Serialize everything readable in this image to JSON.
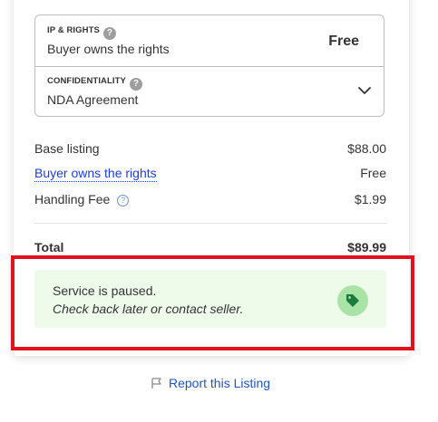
{
  "options": {
    "ip_rights": {
      "label": "IP & RIGHTS",
      "help": "?",
      "value": "Buyer owns the rights",
      "price": "Free"
    },
    "confidentiality": {
      "label": "CONFIDENTIALITY",
      "help": "?",
      "value": "NDA Agreement",
      "icon": "chevron-down-icon"
    }
  },
  "summary": {
    "base_listing": {
      "label": "Base listing",
      "amount": "$88.00"
    },
    "rights": {
      "label": "Buyer owns the rights",
      "amount": "Free"
    },
    "handling_fee": {
      "label": "Handling Fee",
      "help": "?",
      "amount": "$1.99"
    },
    "total": {
      "label": "Total",
      "amount": "$89.99"
    }
  },
  "notice": {
    "title": "Service is paused.",
    "subtitle": "Check back later or contact seller.",
    "icon": "tag-icon"
  },
  "report": {
    "label": "Report this Listing",
    "icon": "flag-icon"
  },
  "colors": {
    "link": "#1a3ee0",
    "notice_bg": "#effbea",
    "tag_circle": "#a9e4a6",
    "tag_icon": "#1b7a3d",
    "highlight": "#e1121e"
  }
}
